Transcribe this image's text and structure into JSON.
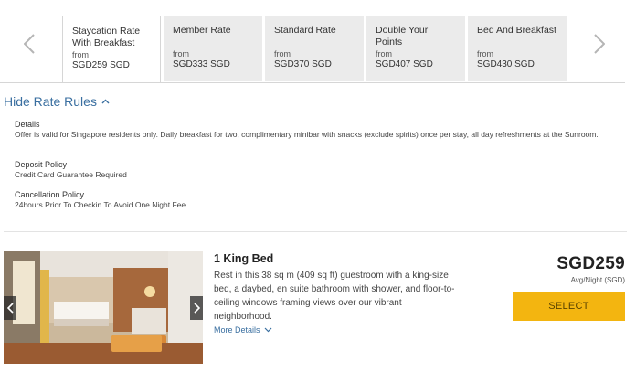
{
  "rates": {
    "tabs": [
      {
        "name": "Staycation Rate With Breakfast",
        "from": "from",
        "price": "SGD259 SGD"
      },
      {
        "name": "Member Rate",
        "from": "from",
        "price": "SGD333 SGD"
      },
      {
        "name": "Standard Rate",
        "from": "from",
        "price": "SGD370 SGD"
      },
      {
        "name": "Double Your Points",
        "from": "from",
        "price": "SGD407 SGD"
      },
      {
        "name": "Bed And Breakfast",
        "from": "from",
        "price": "SGD430 SGD"
      }
    ],
    "active_index": 0
  },
  "rules": {
    "toggle_label": "Hide Rate Rules",
    "details_heading": "Details",
    "details_text": "Offer is valid for Singapore residents only. Daily breakfast for two, complimentary minibar with snacks (exclude spirits) once per stay, all day refreshments at the Sunroom.",
    "deposit_heading": "Deposit Policy",
    "deposit_text": "Credit Card Guarantee Required",
    "cancel_heading": "Cancellation Policy",
    "cancel_text": "24hours Prior To Checkin To Avoid One Night Fee"
  },
  "room": {
    "title": "1 King Bed",
    "description": "Rest in this 38 sq m (409 sq ft) guestroom with a king-size bed, a daybed, en suite bathroom with shower, and floor-to-ceiling windows framing views over our vibrant neighborhood.",
    "more_label": "More Details",
    "price": "SGD259",
    "price_note": "Avg/Night (SGD)",
    "select_label": "SELECT"
  },
  "icons": {
    "prev": "chevron-left-icon",
    "next": "chevron-right-icon",
    "toggle": "chevron-up-icon",
    "more": "chevron-down-icon"
  },
  "colors": {
    "link": "#3a6fa0",
    "select_button": "#f3b510",
    "tab_inactive": "#ebebeb"
  }
}
